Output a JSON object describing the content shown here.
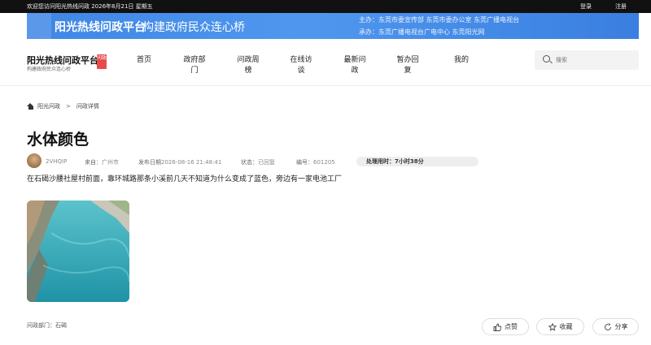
{
  "topbar": {
    "welcome": "欢迎您访问阳光热线问政 2026年8月21日 星期五",
    "login": "登录",
    "register": "注册"
  },
  "banner": {
    "title": "阳光热线问政平台",
    "subtitle": "构建政府民众连心桥",
    "line1": "主办：东莞市委宣传部  东莞市委办公室  东莞广播电视台",
    "line2": "承办：东莞广播电视台广电中心 东莞阳光网"
  },
  "header": {
    "logo_title": "阳光热线问政平台",
    "logo_sub": "构建政府民众连心桥",
    "logo_badge": "问政",
    "nav": [
      {
        "line1": "首页",
        "line2": ""
      },
      {
        "line1": "政府部",
        "line2": "门"
      },
      {
        "line1": "问政周",
        "line2": "榜"
      },
      {
        "line1": "在线访",
        "line2": "谈"
      },
      {
        "line1": "最新问",
        "line2": "政"
      },
      {
        "line1": "暂办回",
        "line2": "复"
      },
      {
        "line1": "我的",
        "line2": ""
      }
    ],
    "search_placeholder": "搜索"
  },
  "breadcrumb": {
    "home": "阳光问政",
    "separator": ">",
    "current": "问政详情"
  },
  "post": {
    "title": "水体颜色",
    "author": "2VHQIP",
    "source_label": "来自：",
    "source": "广州市",
    "date_label": "发布日期",
    "date": "2026-08-16 21:48:41",
    "status_label": "状态：",
    "status": "已回复",
    "id_label": "编号：",
    "id": "601205",
    "handle_time": "处理用时：7小时38分",
    "content": "在石碣沙腰社屋村前面，靠环城路那条小溪前几天不知道为什么变成了蓝色，旁边有一家电池工厂",
    "dept_label": "问政部门：",
    "dept": "石碣"
  },
  "actions": {
    "like": "点赞",
    "favorite": "收藏",
    "share": "分享"
  },
  "colors": {
    "banner": "#4a90e8",
    "topbar": "#111111",
    "badge": "#e84a4a"
  }
}
